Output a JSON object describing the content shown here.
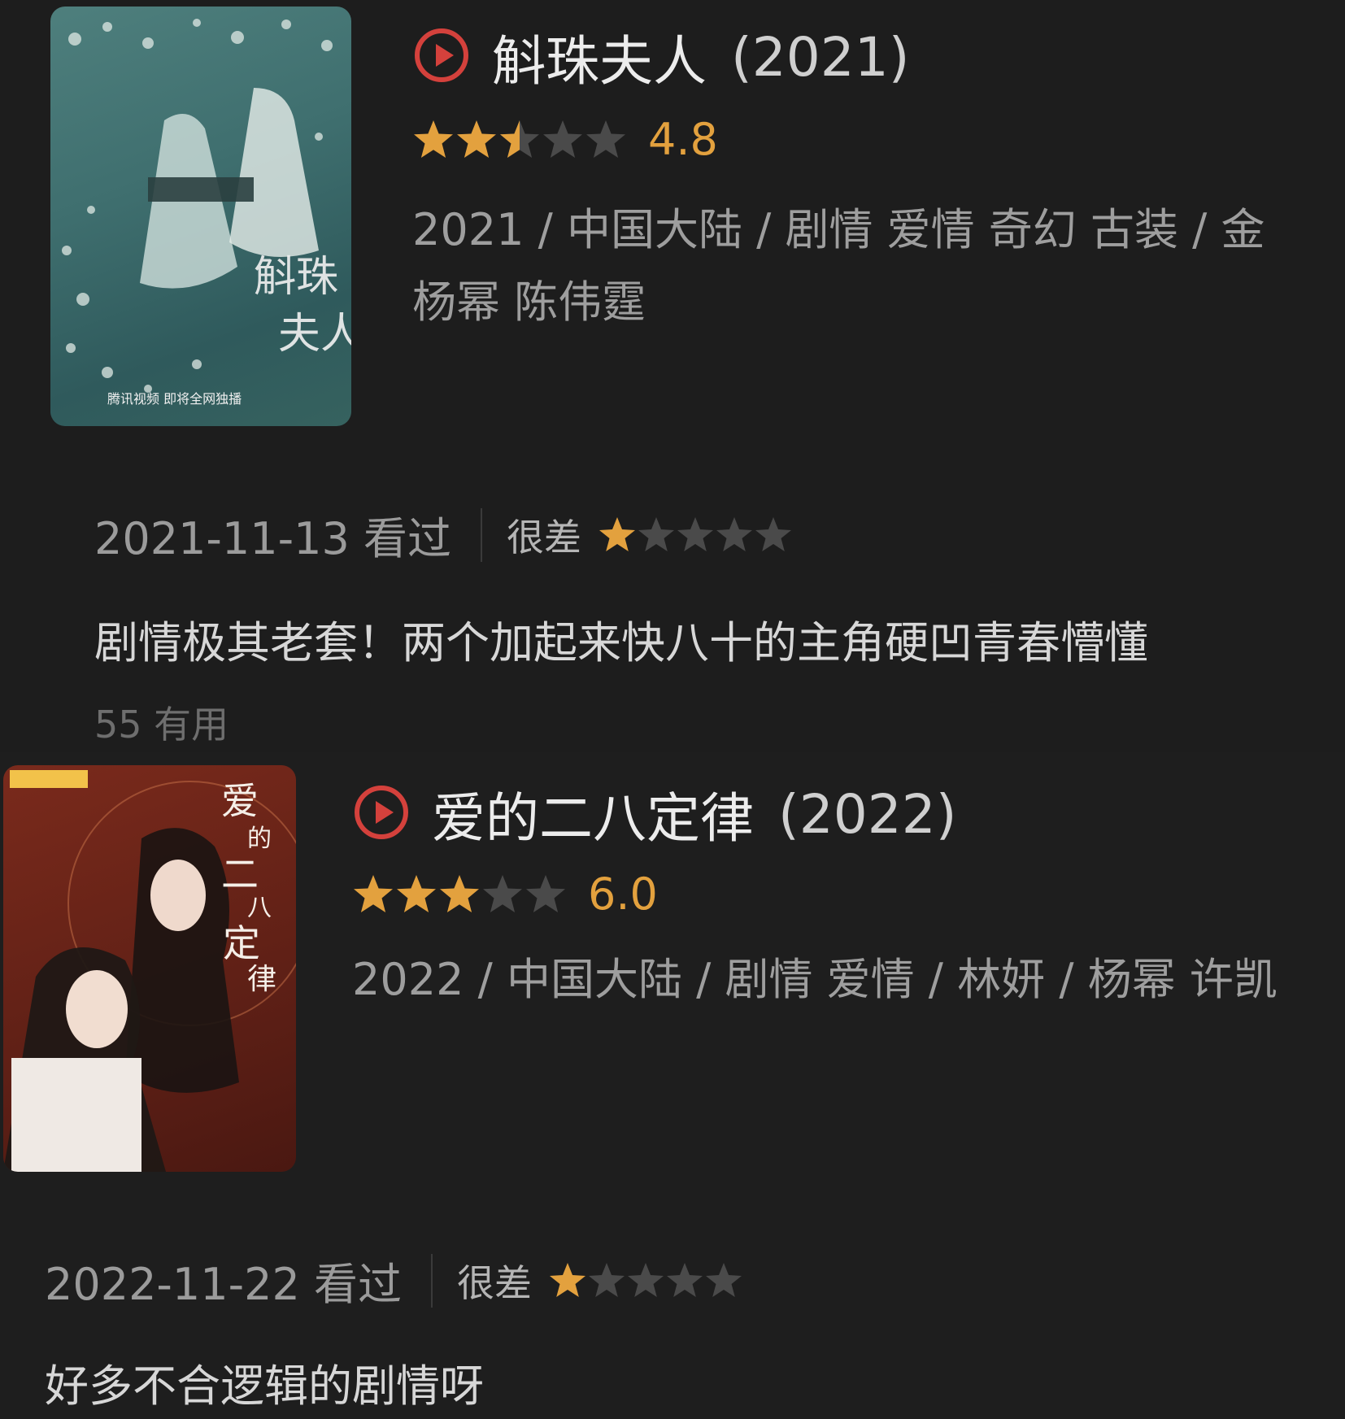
{
  "colors": {
    "background": "#1c1c1c",
    "star_filled": "#e3a13e",
    "star_empty": "#4a4a4a",
    "play_icon": "#d4413c",
    "score": "#e3a13e"
  },
  "entries": [
    {
      "title": "斛珠夫人",
      "year": "(2021)",
      "rating": {
        "stars": 2.5,
        "out_of": 5,
        "score": "4.8"
      },
      "meta": "2021 / 中国大陆 / 剧情 爱情 奇幻 古装 / 金",
      "cast": "杨幂 陈伟霆",
      "poster": {
        "title_calligraphy": "斛珠夫人",
        "caption": "腾讯视频 即将全网独播"
      },
      "review": {
        "date": "2021-11-13 看过",
        "verdict": "很差",
        "user_stars": 1,
        "text": "剧情极其老套！两个加起来快八十的主角硬凹青春懵懂",
        "useful": "55 有用"
      }
    },
    {
      "title": "爱的二八定律",
      "year": "(2022)",
      "rating": {
        "stars": 3,
        "out_of": 5,
        "score": "6.0"
      },
      "meta": "2022 / 中国大陆 / 剧情 爱情 / 林妍 / 杨幂 许凯",
      "poster": {
        "title_calligraphy": "爱的二八定律"
      },
      "review": {
        "date": "2022-11-22 看过",
        "verdict": "很差",
        "user_stars": 1,
        "text": "好多不合逻辑的剧情呀"
      }
    }
  ]
}
